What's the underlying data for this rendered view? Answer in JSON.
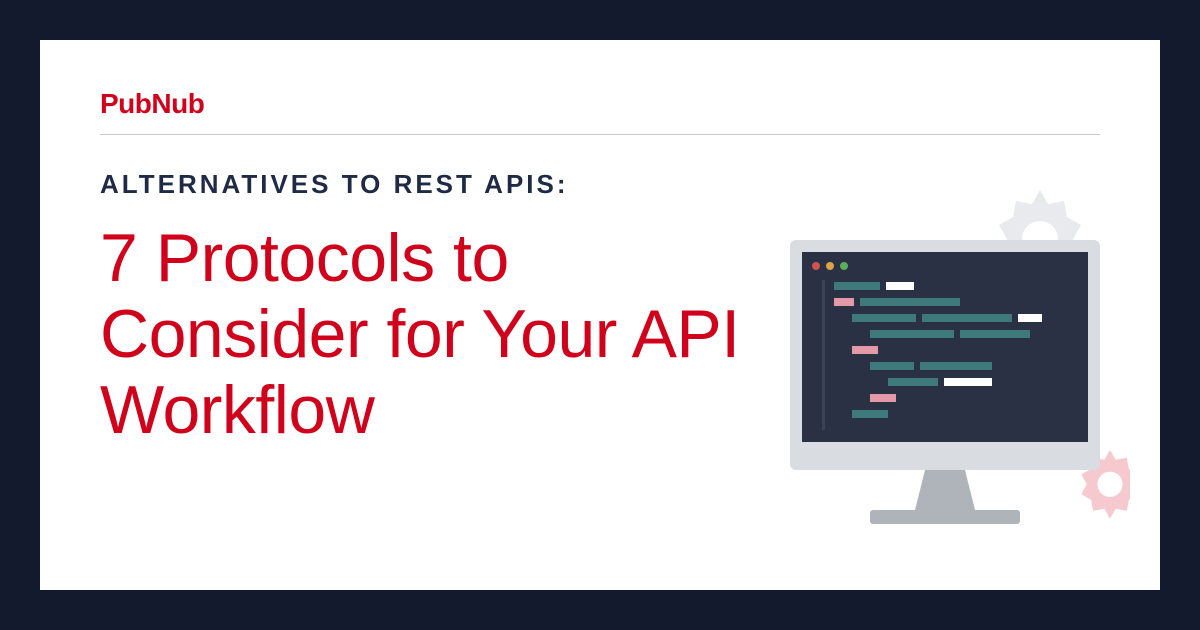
{
  "brand": "PubNub",
  "eyebrow": "ALTERNATIVES TO REST APIS:",
  "headline": "7 Protocols to Consider for Your API Workflow",
  "colors": {
    "frame": "#141a2e",
    "card": "#ffffff",
    "accent": "#d0021b",
    "text_dark": "#1f2a44",
    "divider": "#c9c9c9",
    "gear_light": "#e8eaed",
    "gear_pink": "#f6c9cf",
    "monitor_bezel": "#d9dde2",
    "monitor_panel": "#2b3144",
    "monitor_stand": "#aeb4ba",
    "code_teal": "#3e7a7a",
    "code_pink": "#e49aa6",
    "code_white": "#ffffff"
  },
  "illustration": {
    "name": "desktop-monitor-with-code",
    "gears": [
      "top-right",
      "bottom-right"
    ],
    "window_dots": [
      "#d0524e",
      "#d9a441",
      "#5cae5c"
    ]
  }
}
